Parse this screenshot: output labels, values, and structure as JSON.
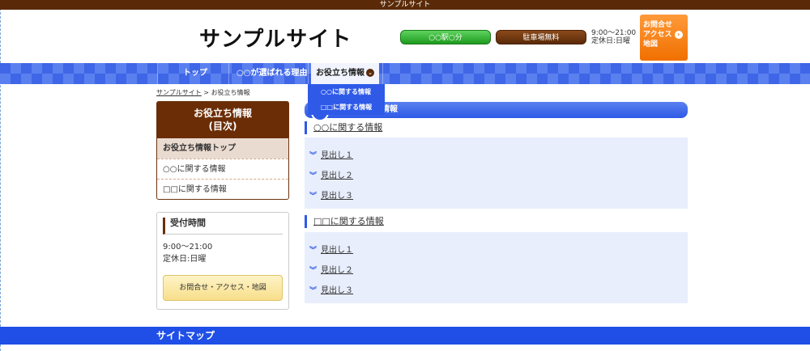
{
  "topbar": {
    "text": "サンプルサイト"
  },
  "header": {
    "site_title": "サンプルサイト",
    "station_pill": "○○駅○分",
    "parking_pill": "駐車場無料",
    "hours_line1": "9:00～21:00",
    "hours_line2": "定休日:日曜",
    "contact_lines": [
      "お問合せ",
      "アクセス",
      "地図"
    ]
  },
  "nav": {
    "items": [
      {
        "label": "トップ"
      },
      {
        "label": "○○が選ばれる理由"
      },
      {
        "label": "お役立ち情報"
      }
    ],
    "dropdown": [
      "○○に関する情報",
      "□□に関する情報"
    ]
  },
  "breadcrumb": {
    "home": "サンプルサイト",
    "sep": " > ",
    "current": "お役立ち情報"
  },
  "sidebar": {
    "toc_title_1": "お役立ち情報",
    "toc_title_2": "(目次)",
    "toc_items": [
      "お役立ち情報トップ",
      "○○に関する情報",
      "□□に関する情報"
    ],
    "hours_title": "受付時間",
    "hours_line1": "9:00～21:00",
    "hours_line2": "定休日:日曜",
    "contact_button": "お問合せ・アクセス・地図"
  },
  "main": {
    "bar_title": "情報",
    "sections": [
      {
        "heading": "○○に関する情報",
        "items": [
          "見出し１",
          "見出し２",
          "見出し３"
        ]
      },
      {
        "heading": "□□に関する情報",
        "items": [
          "見出し１",
          "見出し２",
          "見出し３"
        ]
      }
    ]
  },
  "footer": {
    "title": "サイトマップ"
  }
}
